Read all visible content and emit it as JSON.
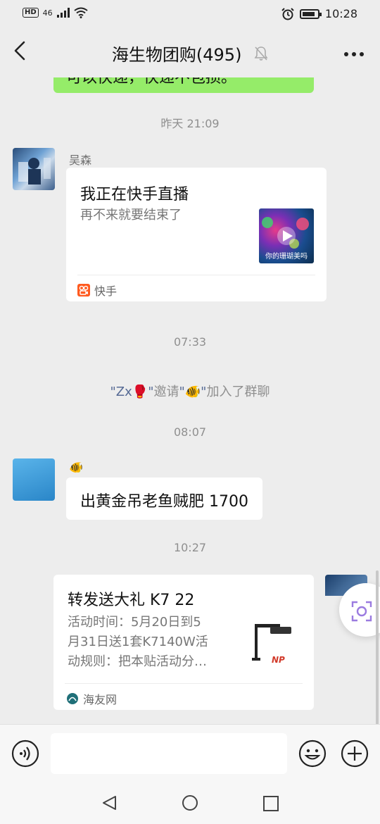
{
  "status_bar": {
    "hd": "HD",
    "signal": "46",
    "time": "10:28"
  },
  "header": {
    "title": "海生物团购(495)",
    "icons": [
      "back-arrow-icon",
      "mute-bell-icon",
      "more-icon"
    ]
  },
  "messages": {
    "partial_bubble_text": "可以快递，快递不包损。",
    "time_1": "昨天 21:09",
    "msg1": {
      "sender": "吴森",
      "card_title": "我正在快手直播",
      "card_desc": "再不来就要结束了",
      "thumb_caption": "你的珊瑚美吗",
      "source": "快手"
    },
    "time_2": "07:33",
    "system": {
      "name1": "\"Zx🥊\"",
      "verb": "邀请",
      "name2": "\"🐠\"",
      "suffix": "加入了群聊"
    },
    "time_3": "08:07",
    "msg2": {
      "sender": "🐠",
      "text": "出黄金吊老鱼贼肥 1700"
    },
    "time_4": "10:27",
    "msg3": {
      "card_title": "转发送大礼 K7 22",
      "card_desc_line1": "活动时间：5月20日到5",
      "card_desc_line2": "月31日送1套K7140W活",
      "card_desc_line3": "动规则：把本贴活动分…",
      "thumb_logo": "NP",
      "source": "海友网"
    }
  },
  "input_bar": {
    "placeholder": "",
    "icons": [
      "voice-icon",
      "emoji-icon",
      "plus-icon"
    ]
  },
  "nav_bar": {
    "icons": [
      "nav-back-icon",
      "nav-home-icon",
      "nav-recent-icon"
    ]
  }
}
